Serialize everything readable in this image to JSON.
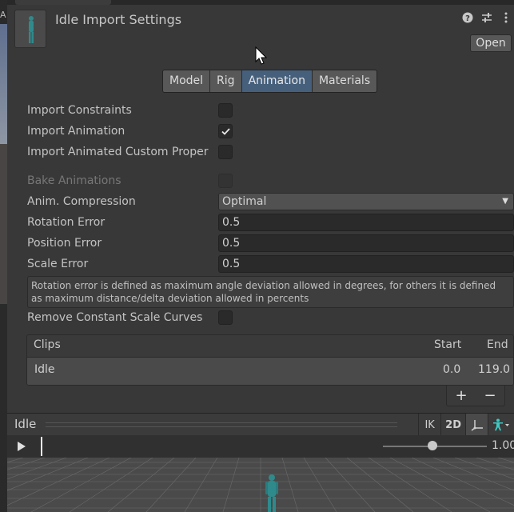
{
  "left_strip": {
    "letter": "A"
  },
  "header": {
    "title": "Idle Import Settings",
    "icons": [
      "help-icon",
      "settings-sliders-icon",
      "more-vert-icon"
    ],
    "open_label": "Open"
  },
  "tabs": [
    {
      "label": "Model",
      "active": false
    },
    {
      "label": "Rig",
      "active": false
    },
    {
      "label": "Animation",
      "active": true
    },
    {
      "label": "Materials",
      "active": false
    }
  ],
  "settings": {
    "import_constraints": {
      "label": "Import Constraints",
      "checked": false
    },
    "import_animation": {
      "label": "Import Animation",
      "checked": true
    },
    "import_custom_props": {
      "label": "Import Animated Custom Proper",
      "checked": false
    },
    "bake_animations": {
      "label": "Bake Animations",
      "checked": false,
      "disabled": true
    },
    "anim_compression": {
      "label": "Anim. Compression",
      "value": "Optimal"
    },
    "rotation_error": {
      "label": "Rotation Error",
      "value": "0.5"
    },
    "position_error": {
      "label": "Position Error",
      "value": "0.5"
    },
    "scale_error": {
      "label": "Scale Error",
      "value": "0.5"
    },
    "help_line1": "Rotation error is defined as maximum angle deviation allowed in degrees, for others it is defined",
    "help_line2": "as maximum distance/delta deviation allowed in percents",
    "remove_constant_scale": {
      "label": "Remove Constant Scale Curves",
      "checked": false
    }
  },
  "clips": {
    "header": {
      "title": "Clips",
      "start": "Start",
      "end": "End"
    },
    "rows": [
      {
        "name": "Idle",
        "start": "0.0",
        "end": "119.0"
      }
    ],
    "add_label": "+",
    "remove_label": "−"
  },
  "preview": {
    "clip_name": "Idle",
    "ik_label": "IK",
    "mode_2d_label": "2D",
    "speed_value": "1.00",
    "speed_fraction": 0.5
  },
  "colors": {
    "accent_tab": "#46607c",
    "figure": "#2f8a8c"
  }
}
